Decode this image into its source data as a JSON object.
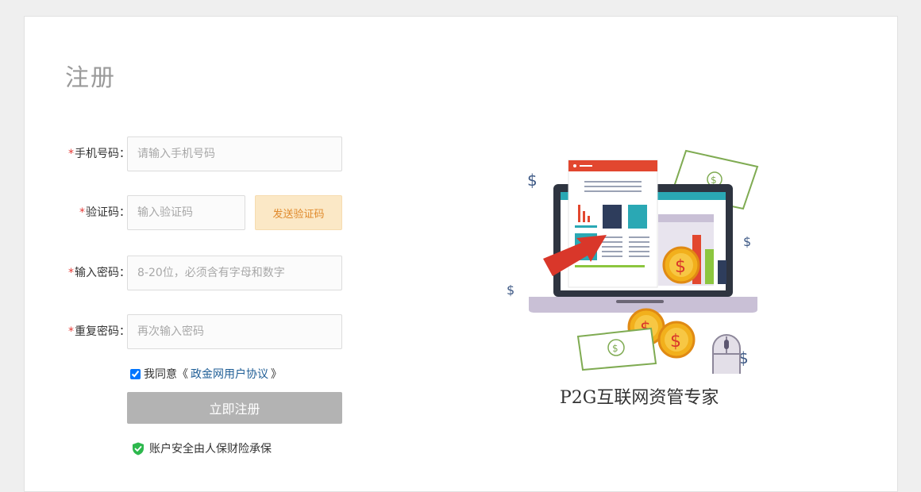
{
  "page": {
    "title": "注册"
  },
  "form": {
    "required_mark": "*",
    "phone": {
      "label": "手机号码：",
      "placeholder": "请输入手机号码"
    },
    "code": {
      "label": "验证码：",
      "placeholder": "输入验证码",
      "send_label": "发送验证码"
    },
    "password": {
      "label": "输入密码：",
      "placeholder": "8-20位，必须含有字母和数字"
    },
    "confirm": {
      "label": "重复密码：",
      "placeholder": "再次输入密码"
    },
    "agree": {
      "prefix": "我同意《",
      "link": "政金网用户协议",
      "suffix": "》",
      "checked": true
    },
    "submit_label": "立即注册",
    "security_note": "账户安全由人保财险承保"
  },
  "illustration": {
    "icon": "laptop-finance-illustration",
    "slogan": "P2G互联网资管专家",
    "currency_symbol": "$"
  },
  "colors": {
    "background": "#efefef",
    "card": "#ffffff",
    "send_button_bg": "#fbe8c6",
    "send_button_text": "#e08a2c",
    "submit_bg": "#b3b3b3",
    "link": "#1f5e96",
    "required": "#e53935",
    "shield": "#2db84d"
  }
}
